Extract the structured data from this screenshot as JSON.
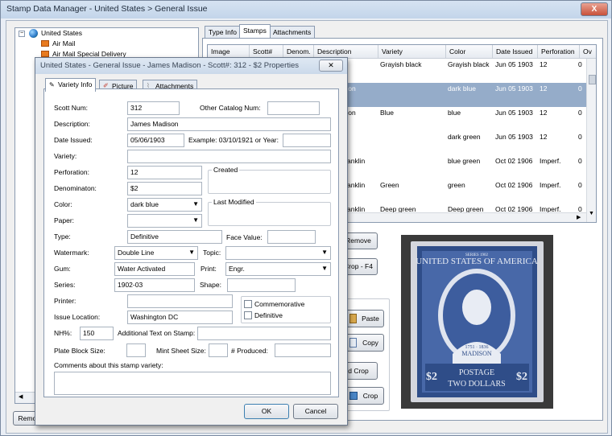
{
  "main": {
    "title": "Stamp Data Manager - United States > General Issue",
    "close_label": "X",
    "tree": [
      "United States",
      "Air Mail",
      "Air Mail Special Delivery"
    ],
    "tabs": [
      "Type Info",
      "Stamps",
      "Attachments"
    ],
    "grid": {
      "columns": [
        "Image",
        "Scott#",
        "Denom.",
        "Description",
        "Variety",
        "Color",
        "Date Issued",
        "Perforation",
        "Ov"
      ],
      "rows": [
        {
          "description": "",
          "variety": "Grayish black",
          "color": "Grayish black",
          "date": "Jun 05 1903",
          "perf": "12",
          "ov": "0"
        },
        {
          "description": "son",
          "variety": "",
          "color": "dark blue",
          "date": "Jun 05 1903",
          "perf": "12",
          "ov": "0"
        },
        {
          "description": "son",
          "variety": "Blue",
          "color": "blue",
          "date": "Jun 05 1903",
          "perf": "12",
          "ov": "0"
        },
        {
          "description": "",
          "variety": "",
          "color": "dark green",
          "date": "Jun 05 1903",
          "perf": "12",
          "ov": "0"
        },
        {
          "description": "anklin",
          "variety": "",
          "color": "blue green",
          "date": "Oct 02 1906",
          "perf": "Imperf.",
          "ov": "0"
        },
        {
          "description": "anklin",
          "variety": "Green",
          "color": "green",
          "date": "Oct 02 1906",
          "perf": "Imperf.",
          "ov": "0"
        },
        {
          "description": "anklin",
          "variety": "Deep green",
          "color": "Deep green",
          "date": "Oct 02 1906",
          "perf": "Imperf.",
          "ov": "0"
        }
      ]
    },
    "buttons": {
      "remove": "Remove",
      "crop_f4": "Crop - F4",
      "paste": "Paste",
      "copy": "Copy",
      "d_crop": "d Crop",
      "crop": "Crop",
      "remove_bottom": "Remov"
    }
  },
  "dialog": {
    "title": "United States - General Issue -  James Madison -  Scott#: 312 -  $2    Properties",
    "tabs": [
      "Variety Info",
      "Picture",
      "Attachments"
    ],
    "labels": {
      "scott_num": "Scott Num:",
      "other_catalog": "Other Catalog Num:",
      "description": "Description:",
      "date_issued": "Date Issued:",
      "date_example": "Example: 03/10/1921 or Year:",
      "variety": "Variety:",
      "perforation": "Perforation:",
      "created": "Created",
      "denomination": "Denominaton:",
      "color": "Color:",
      "last_modified": "Last Modified",
      "paper": "Paper:",
      "type": "Type:",
      "face_value": "Face Value:",
      "watermark": "Watermark:",
      "topic": "Topic:",
      "gum": "Gum:",
      "print": "Print:",
      "series": "Series:",
      "shape": "Shape:",
      "printer": "Printer:",
      "commemorative": "Commemorative",
      "definitive": "Definitive",
      "issue_location": "Issue Location:",
      "nh": "NH%:",
      "additional_text": "Additional Text on Stamp:",
      "plate_block": "Plate Block Size:",
      "mint_sheet": "Mint Sheet Size:",
      "produced": "# Produced:",
      "comments": "Comments about this stamp variety:"
    },
    "values": {
      "scott_num": "312",
      "description": "James Madison",
      "date_issued": "05/06/1903",
      "perforation": "12",
      "denomination": "$2",
      "color": "dark blue",
      "type": "Definitive",
      "watermark": "Double Line",
      "gum": "Water Activated",
      "print": "Engr.",
      "series": "1902-03",
      "issue_location": "Washington DC",
      "nh": "150"
    },
    "ok": "OK",
    "cancel": "Cancel"
  },
  "stamp": {
    "top_text": "UNITED STATES OF AMERICA",
    "name": "MADISON",
    "years": "1751 · 1836",
    "bottom1": "POSTAGE",
    "bottom2": "TWO DOLLARS",
    "denom": "$2",
    "series": "SERIES 1902",
    "ink_color": "#2f4d88"
  }
}
